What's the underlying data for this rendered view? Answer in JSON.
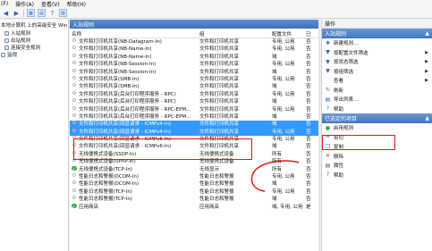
{
  "menu": [
    "(F)",
    "操作(A)",
    "查看(V)",
    "帮助(H)"
  ],
  "tree": {
    "root": "本地计算机 上的高级安全 Win",
    "items": [
      "入站规则",
      "出站规则",
      "连接安全规则",
      "监视"
    ]
  },
  "list": {
    "title": "入站规则",
    "columns": {
      "name": "名称",
      "group": "组",
      "profile": "配置文件",
      "enabled": "已"
    },
    "rows": [
      {
        "name": "文件和打印机共享(NB-Datagram-In)",
        "group": "文件和打印机共享",
        "profile": "专用, 公用",
        "enabled": "否",
        "check": false,
        "selected": false
      },
      {
        "name": "文件和打印机共享(NB-Name-In)",
        "group": "文件和打印机共享",
        "profile": "专用, 公用",
        "enabled": "否",
        "check": false,
        "selected": false
      },
      {
        "name": "文件和打印机共享(NB-Name-In)",
        "group": "文件和打印机共享",
        "profile": "域",
        "enabled": "否",
        "check": false,
        "selected": false
      },
      {
        "name": "文件和打印机共享(NB-Session-In)",
        "group": "文件和打印机共享",
        "profile": "专用, 公用",
        "enabled": "否",
        "check": false,
        "selected": false
      },
      {
        "name": "文件和打印机共享(NB-Session-In)",
        "group": "文件和打印机共享",
        "profile": "域",
        "enabled": "否",
        "check": false,
        "selected": false
      },
      {
        "name": "文件和打印机共享(SMB-In)",
        "group": "文件和打印机共享",
        "profile": "专用, 公用",
        "enabled": "否",
        "check": false,
        "selected": false
      },
      {
        "name": "文件和打印机共享(SMB-In)",
        "group": "文件和打印机共享",
        "profile": "域",
        "enabled": "否",
        "check": false,
        "selected": false
      },
      {
        "name": "文件和打印机共享(后台打印程序服务 - RPC)",
        "group": "文件和打印机共享",
        "profile": "专用, 公用",
        "enabled": "否",
        "check": false,
        "selected": false
      },
      {
        "name": "文件和打印机共享(后台打印程序服务 - RPC)",
        "group": "文件和打印机共享",
        "profile": "域",
        "enabled": "否",
        "check": false,
        "selected": false
      },
      {
        "name": "文件和打印机共享(后台打印程序服务 - RPC-EPM...",
        "group": "文件和打印机共享",
        "profile": "专用, 公用",
        "enabled": "否",
        "check": false,
        "selected": false
      },
      {
        "name": "文件和打印机共享(后台打印程序服务 - RPC-EPM...",
        "group": "文件和打印机共享",
        "profile": "域",
        "enabled": "否",
        "check": false,
        "selected": false
      },
      {
        "name": "文件和打印机共享(回显请求 - ICMPv4-In)",
        "group": "文件和打印机共享",
        "profile": "域",
        "enabled": "否",
        "check": false,
        "selected": true
      },
      {
        "name": "文件和打印机共享(回显请求 - ICMPv4-In)",
        "group": "文件和打印机共享",
        "profile": "专用, 公用",
        "enabled": "否",
        "check": false,
        "selected": true
      },
      {
        "name": "文件和打印机共享(回显请求 - ICMPv6-In)",
        "group": "文件和打印机共享",
        "profile": "专用, 公用",
        "enabled": "否",
        "check": false,
        "selected": false
      },
      {
        "name": "文件和打印机共享(回显请求 - ICMPv6-In)",
        "group": "文件和打印机共享",
        "profile": "域",
        "enabled": "否",
        "check": false,
        "selected": false
      },
      {
        "name": "无线便携式设备(SSDP-In)",
        "group": "无线便携式设备",
        "profile": "所有",
        "enabled": "否",
        "check": false,
        "selected": false
      },
      {
        "name": "无线便携式设备(UPnP-In)",
        "group": "无线便携式设备",
        "profile": "所有",
        "enabled": "否",
        "check": false,
        "selected": false
      },
      {
        "name": "无线便携式设备(TCP-In)",
        "group": "无线显示",
        "profile": "所有",
        "enabled": "否",
        "check": true,
        "selected": false
      },
      {
        "name": "性能日志和警报(DCOM-In)",
        "group": "性能日志和警报",
        "profile": "专用, 公用",
        "enabled": "否",
        "check": false,
        "selected": false
      },
      {
        "name": "性能日志和警报(DCOM-In)",
        "group": "性能日志和警报",
        "profile": "域",
        "enabled": "否",
        "check": false,
        "selected": false
      },
      {
        "name": "性能日志和警报(TCP-In)",
        "group": "性能日志和警报",
        "profile": "专用, 公用",
        "enabled": "否",
        "check": false,
        "selected": false
      },
      {
        "name": "性能日志和警报(TCP-In)",
        "group": "性能日志和警报",
        "profile": "域",
        "enabled": "否",
        "check": false,
        "selected": false
      },
      {
        "name": "应用商店",
        "group": "应用商店",
        "profile": "域, 专用, 公用",
        "enabled": "是",
        "check": true,
        "selected": false
      }
    ]
  },
  "actions": {
    "title": "操作",
    "section1": "入站规则",
    "items1": [
      {
        "label": "新建规则...",
        "icon": "new-rule-icon",
        "arrow": false
      },
      {
        "label": "按配置文件筛选",
        "icon": "filter-icon",
        "arrow": true
      },
      {
        "label": "按状态筛选",
        "icon": "filter-icon",
        "arrow": true
      },
      {
        "label": "按组筛选",
        "icon": "filter-icon",
        "arrow": true
      },
      {
        "label": "查看",
        "icon": "view-icon",
        "arrow": true
      },
      {
        "label": "刷新",
        "icon": "refresh-icon",
        "arrow": false
      },
      {
        "label": "导出列表...",
        "icon": "export-icon",
        "arrow": false
      },
      {
        "label": "帮助",
        "icon": "help-icon",
        "arrow": false
      }
    ],
    "section2": "已选定的项目",
    "items2": [
      {
        "label": "启用规则",
        "icon": "enable-icon"
      },
      {
        "label": "剪切",
        "icon": "cut-icon"
      },
      {
        "label": "复制",
        "icon": "copy-icon"
      },
      {
        "label": "删除",
        "icon": "delete-icon"
      },
      {
        "label": "属性",
        "icon": "properties-icon"
      },
      {
        "label": "帮助",
        "icon": "help-icon"
      }
    ]
  },
  "colors": {
    "selection": "#3399ff",
    "annotation": "#e01818",
    "header": "#4276bf"
  }
}
